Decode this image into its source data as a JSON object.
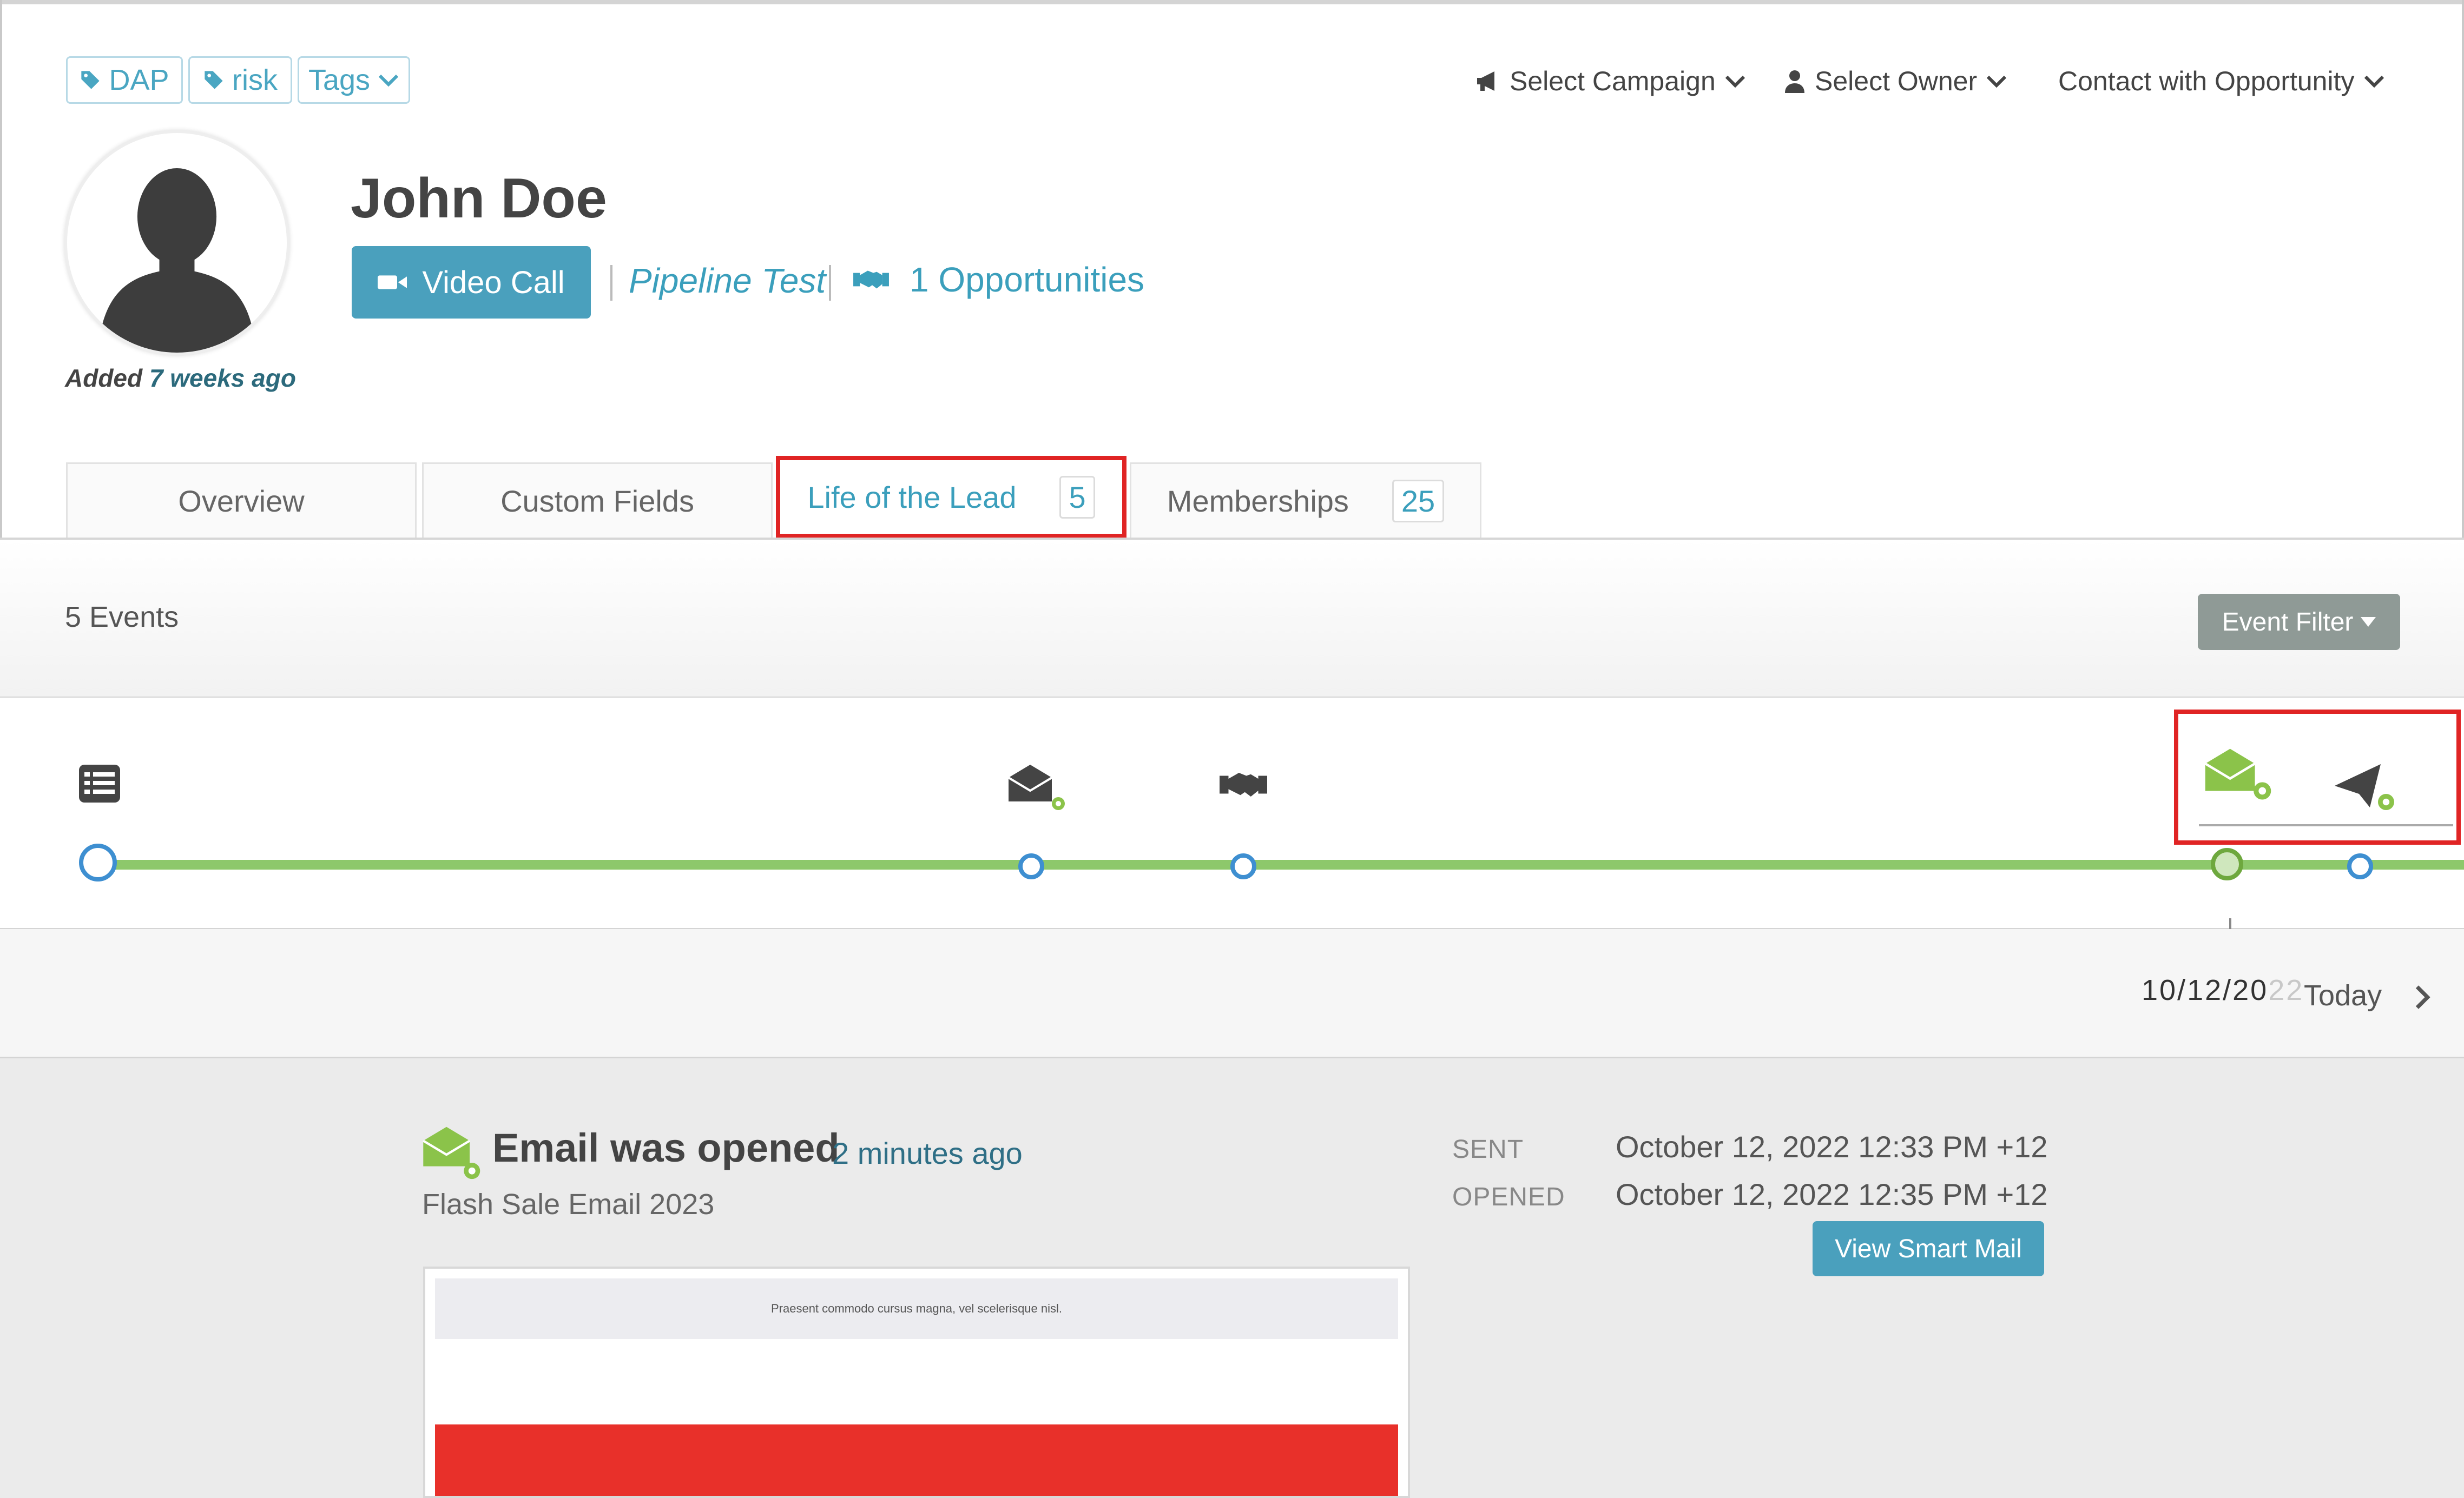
{
  "tags": [
    {
      "label": "DAP"
    },
    {
      "label": "risk"
    }
  ],
  "tags_dropdown_label": "Tags",
  "top_menu": {
    "campaign": "Select Campaign",
    "owner": "Select Owner",
    "contact": "Contact with Opportunity"
  },
  "contact": {
    "name": "John Doe",
    "added_prefix": "Added",
    "added_time": "7 weeks ago",
    "video_call": "Video Call",
    "pipeline": "Pipeline Test",
    "opportunities": "1 Opportunities"
  },
  "tabs": [
    {
      "label": "Overview"
    },
    {
      "label": "Custom Fields"
    },
    {
      "label": "Life of the Lead",
      "count": "5"
    },
    {
      "label": "Memberships",
      "count": "25"
    }
  ],
  "events": {
    "count_label": "5 Events",
    "filter_label": "Event Filter"
  },
  "timeline": {
    "date": "10/12/20",
    "date_faded": "22",
    "today": "Today"
  },
  "event_detail": {
    "title": "Email was opened",
    "time_ago": "2 minutes ago",
    "subtitle": "Flash Sale Email 2023",
    "sent_label": "SENT",
    "sent_value": "October 12, 2022 12:33 PM +12",
    "opened_label": "OPENED",
    "opened_value": "October 12, 2022 12:35 PM +12",
    "view_button": "View Smart Mail",
    "preview_text": "Praesent commodo cursus magna, vel scelerisque nisl."
  },
  "colors": {
    "accent": "#4aa0bd",
    "timeline_green": "#8dc86b",
    "email_green": "#8bc34a",
    "highlight_red": "#e02424",
    "node_blue": "#3e8fd1"
  }
}
